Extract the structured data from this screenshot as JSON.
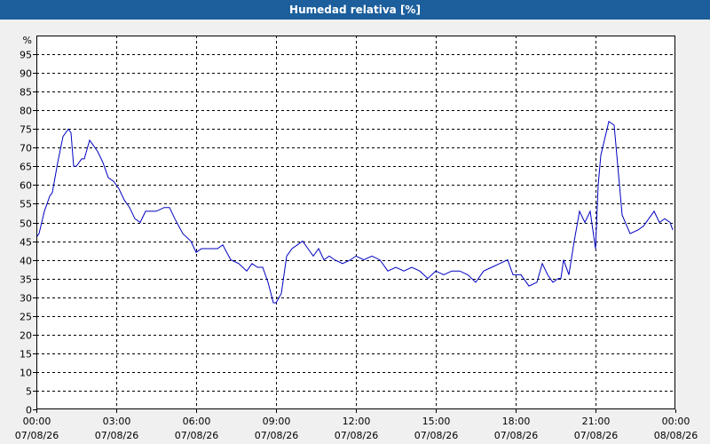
{
  "chart_data": {
    "type": "line",
    "title": "Humedad relativa [%]",
    "ylabel": "%",
    "ylim": [
      0,
      100
    ],
    "yticks": [
      0,
      5,
      10,
      15,
      20,
      25,
      30,
      35,
      40,
      45,
      50,
      55,
      60,
      65,
      70,
      75,
      80,
      85,
      90,
      95
    ],
    "xlim": [
      0,
      24
    ],
    "xticks": [
      {
        "x": 0,
        "time": "00:00",
        "date": "07/08/26"
      },
      {
        "x": 3,
        "time": "03:00",
        "date": "07/08/26"
      },
      {
        "x": 6,
        "time": "06:00",
        "date": "07/08/26"
      },
      {
        "x": 9,
        "time": "09:00",
        "date": "07/08/26"
      },
      {
        "x": 12,
        "time": "12:00",
        "date": "07/08/26"
      },
      {
        "x": 15,
        "time": "15:00",
        "date": "07/08/26"
      },
      {
        "x": 18,
        "time": "18:00",
        "date": "07/08/26"
      },
      {
        "x": 21,
        "time": "21:00",
        "date": "07/08/26"
      },
      {
        "x": 24,
        "time": "00:00",
        "date": "08/08/26"
      }
    ],
    "grid": true,
    "series": [
      {
        "color": "#0000c0",
        "x": [
          0,
          0.1,
          0.3,
          0.5,
          0.6,
          0.8,
          1.0,
          1.2,
          1.3,
          1.4,
          1.5,
          1.7,
          1.8,
          2.0,
          2.1,
          2.3,
          2.5,
          2.7,
          2.9,
          3.1,
          3.3,
          3.5,
          3.7,
          3.9,
          4.1,
          4.3,
          4.5,
          4.8,
          5.0,
          5.2,
          5.5,
          5.8,
          6.0,
          6.2,
          6.5,
          6.8,
          7.0,
          7.3,
          7.6,
          7.9,
          8.1,
          8.3,
          8.5,
          8.7,
          8.9,
          9.0,
          9.2,
          9.4,
          9.6,
          9.8,
          10.0,
          10.2,
          10.4,
          10.6,
          10.8,
          11.0,
          11.2,
          11.5,
          11.8,
          12.0,
          12.3,
          12.6,
          12.9,
          13.2,
          13.5,
          13.8,
          14.1,
          14.4,
          14.7,
          15.0,
          15.3,
          15.6,
          15.9,
          16.2,
          16.5,
          16.8,
          17.1,
          17.4,
          17.7,
          17.9,
          18.2,
          18.5,
          18.8,
          19.0,
          19.2,
          19.4,
          19.6,
          19.7,
          19.8,
          20.0,
          20.2,
          20.4,
          20.6,
          20.8,
          21.0,
          21.1,
          21.2,
          21.3,
          21.5,
          21.7,
          22.0,
          22.3,
          22.6,
          22.8,
          23.0,
          23.2,
          23.4,
          23.6,
          23.8,
          23.9
        ],
        "y": [
          46,
          47,
          53,
          57,
          58,
          66,
          73,
          75,
          74,
          65,
          65,
          67,
          67,
          72,
          71,
          69,
          66,
          62,
          61,
          59,
          56,
          54,
          51,
          50,
          53,
          53,
          53,
          54,
          54,
          51,
          47,
          45,
          42,
          43,
          43,
          43,
          44,
          40,
          39,
          37,
          39,
          38,
          38,
          34,
          28.5,
          28.5,
          31,
          41,
          43,
          44,
          45,
          43,
          41,
          43,
          40,
          41,
          40,
          39,
          40,
          41,
          40,
          41,
          40,
          37,
          38,
          37,
          38,
          37,
          35,
          37,
          36,
          37,
          37,
          36,
          34,
          37,
          38,
          39,
          40,
          36,
          36,
          33,
          34,
          39,
          36,
          34,
          35,
          35,
          40,
          36,
          45,
          53,
          50,
          53,
          43,
          60,
          68,
          71,
          77,
          76,
          52,
          47,
          48,
          49,
          51,
          53,
          50,
          51,
          50,
          48
        ]
      }
    ]
  }
}
